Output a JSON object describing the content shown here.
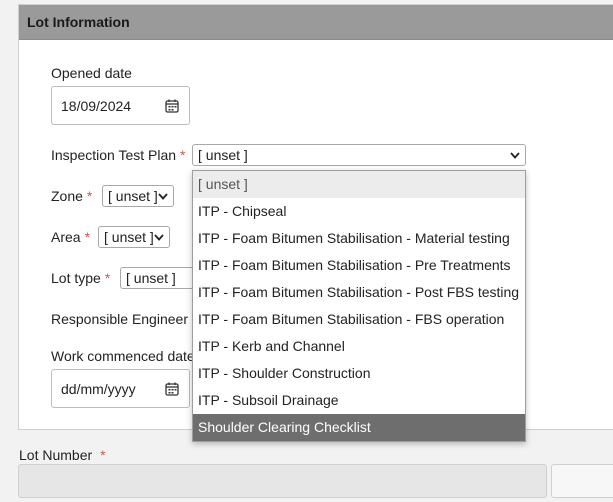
{
  "panel": {
    "title": "Lot Information"
  },
  "form": {
    "opened_date": {
      "label": "Opened date",
      "value": "18/09/2024"
    },
    "itp": {
      "label": "Inspection Test Plan",
      "required": "*",
      "value": "[ unset ]"
    },
    "zone": {
      "label": "Zone",
      "required": "*",
      "value": "[ unset ]"
    },
    "area": {
      "label": "Area",
      "required": "*",
      "value": "[ unset ]"
    },
    "lot_type": {
      "label": "Lot type",
      "required": "*",
      "value": "[ unset ]"
    },
    "responsible_engineer": {
      "label": "Responsible Engineer",
      "required": "*"
    },
    "work_commenced": {
      "label": "Work commenced date",
      "placeholder": "dd/mm/yyyy"
    }
  },
  "dropdown": {
    "options": [
      "[ unset ]",
      "ITP - Chipseal",
      "ITP - Foam Bitumen Stabilisation - Material testing",
      "ITP - Foam Bitumen Stabilisation - Pre Treatments",
      "ITP - Foam Bitumen Stabilisation - Post FBS testing",
      "ITP - Foam Bitumen Stabilisation - FBS operation",
      "ITP - Kerb and Channel",
      "ITP - Shoulder Construction",
      "ITP - Subsoil Drainage",
      "Shoulder Clearing Checklist"
    ],
    "highlighted_index": 9
  },
  "lot_number": {
    "label": "Lot Number",
    "required": "*"
  },
  "colors": {
    "header_bg": "#9a9a9a",
    "required": "#d9534f",
    "highlight": "#6e6e6e"
  }
}
